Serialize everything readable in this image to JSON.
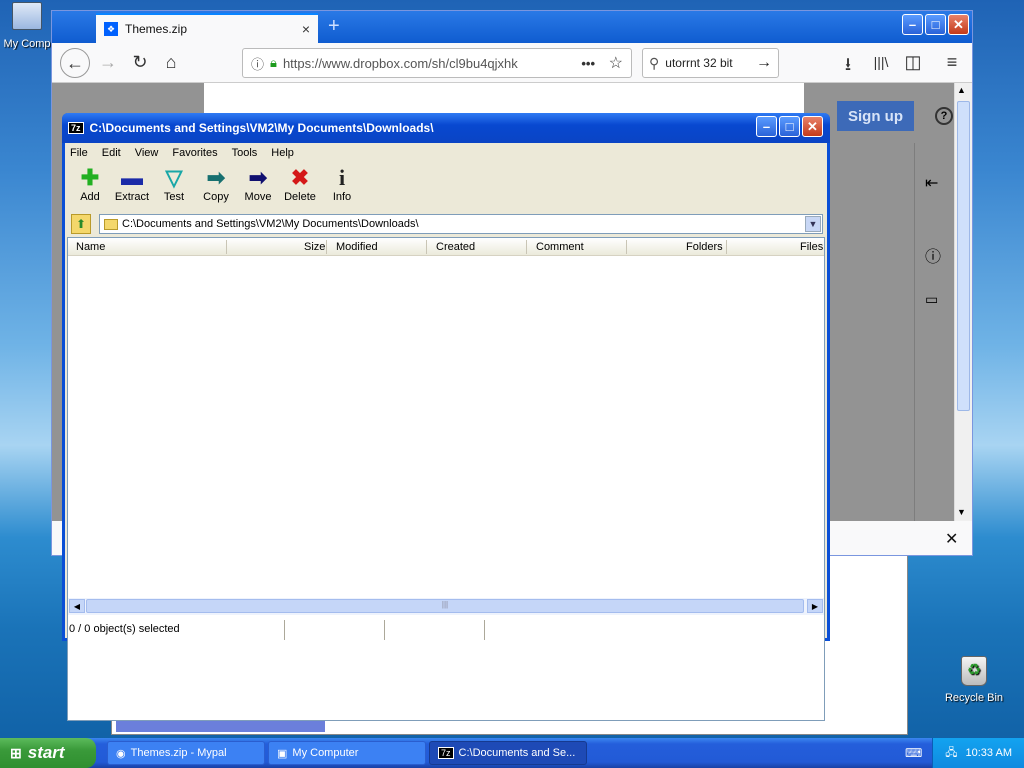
{
  "desktop": {
    "icons": [
      {
        "label": "My Comp",
        "icon": "computer-icon"
      },
      {
        "label": "Recycle Bin",
        "icon": "recycle-bin-icon"
      }
    ]
  },
  "browser": {
    "tab_title": "Themes.zip",
    "url": "https://www.dropbox.com/sh/cl9bu4qjxhk",
    "search_value": "utorrnt 32 bit",
    "signup_label": "Sign up"
  },
  "zip": {
    "title": "C:\\Documents and Settings\\VM2\\My Documents\\Downloads\\",
    "menu": [
      "File",
      "Edit",
      "View",
      "Favorites",
      "Tools",
      "Help"
    ],
    "toolbar": [
      "Add",
      "Extract",
      "Test",
      "Copy",
      "Move",
      "Delete",
      "Info"
    ],
    "path": "C:\\Documents and Settings\\VM2\\My Documents\\Downloads\\",
    "columns": [
      "Name",
      "Size",
      "Modified",
      "Created",
      "Comment",
      "Folders",
      "Files"
    ],
    "status": "0 / 0 object(s) selected"
  },
  "taskbar": {
    "start_label": "start",
    "tasks": [
      "Themes.zip - Mypal",
      "My Computer",
      "C:\\Documents and Se..."
    ],
    "clock": "10:33 AM"
  }
}
